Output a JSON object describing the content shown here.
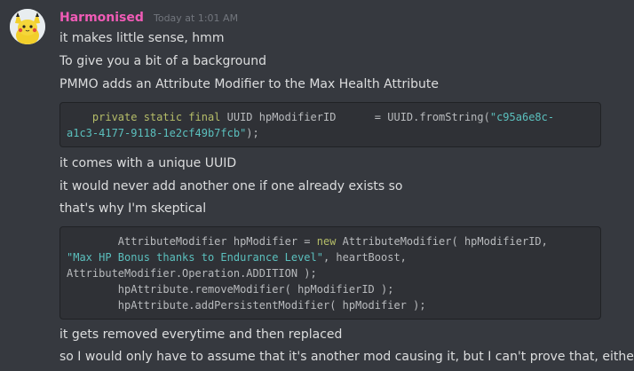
{
  "message": {
    "author": "Harmonised",
    "timestamp": "Today at 1:01 AM",
    "author_color": "#f05bb6",
    "avatar_icon": "pikachu-avatar"
  },
  "lines": [
    "it makes little sense, hmm",
    "To give you a bit of a background",
    "PMMO adds an Attribute Modifier to the Max Health Attribute",
    "it comes with a unique UUID",
    "it would never add another one if one already exists so",
    "that's why I'm skeptical",
    "it gets removed everytime and then replaced",
    "so I would only have to assume that it's another mod causing it, but I can't prove that, either :/"
  ],
  "code1": {
    "l1_indent": "    ",
    "l1_kw": "private static final",
    "l1_mid": " UUID hpModifierID      = UUID.fromString(",
    "l1_str": "\"c95a6e8c-",
    "l2_str": "a1c3-4177-9118-1e2cf49b7fcb\"",
    "l2_end": ");"
  },
  "code2": {
    "l1_a": "        AttributeModifier hpModifier = ",
    "l1_kw": "new",
    "l1_b": " AttributeModifier( hpModifierID,",
    "l2_str": "\"Max HP Bonus thanks to Endurance Level\"",
    "l2_b": ", heartBoost,",
    "l3": "AttributeModifier.Operation.ADDITION );",
    "l4": "        hpAttribute.removeModifier( hpModifierID );",
    "l5": "        hpAttribute.addPersistentModifier( hpModifier );"
  }
}
